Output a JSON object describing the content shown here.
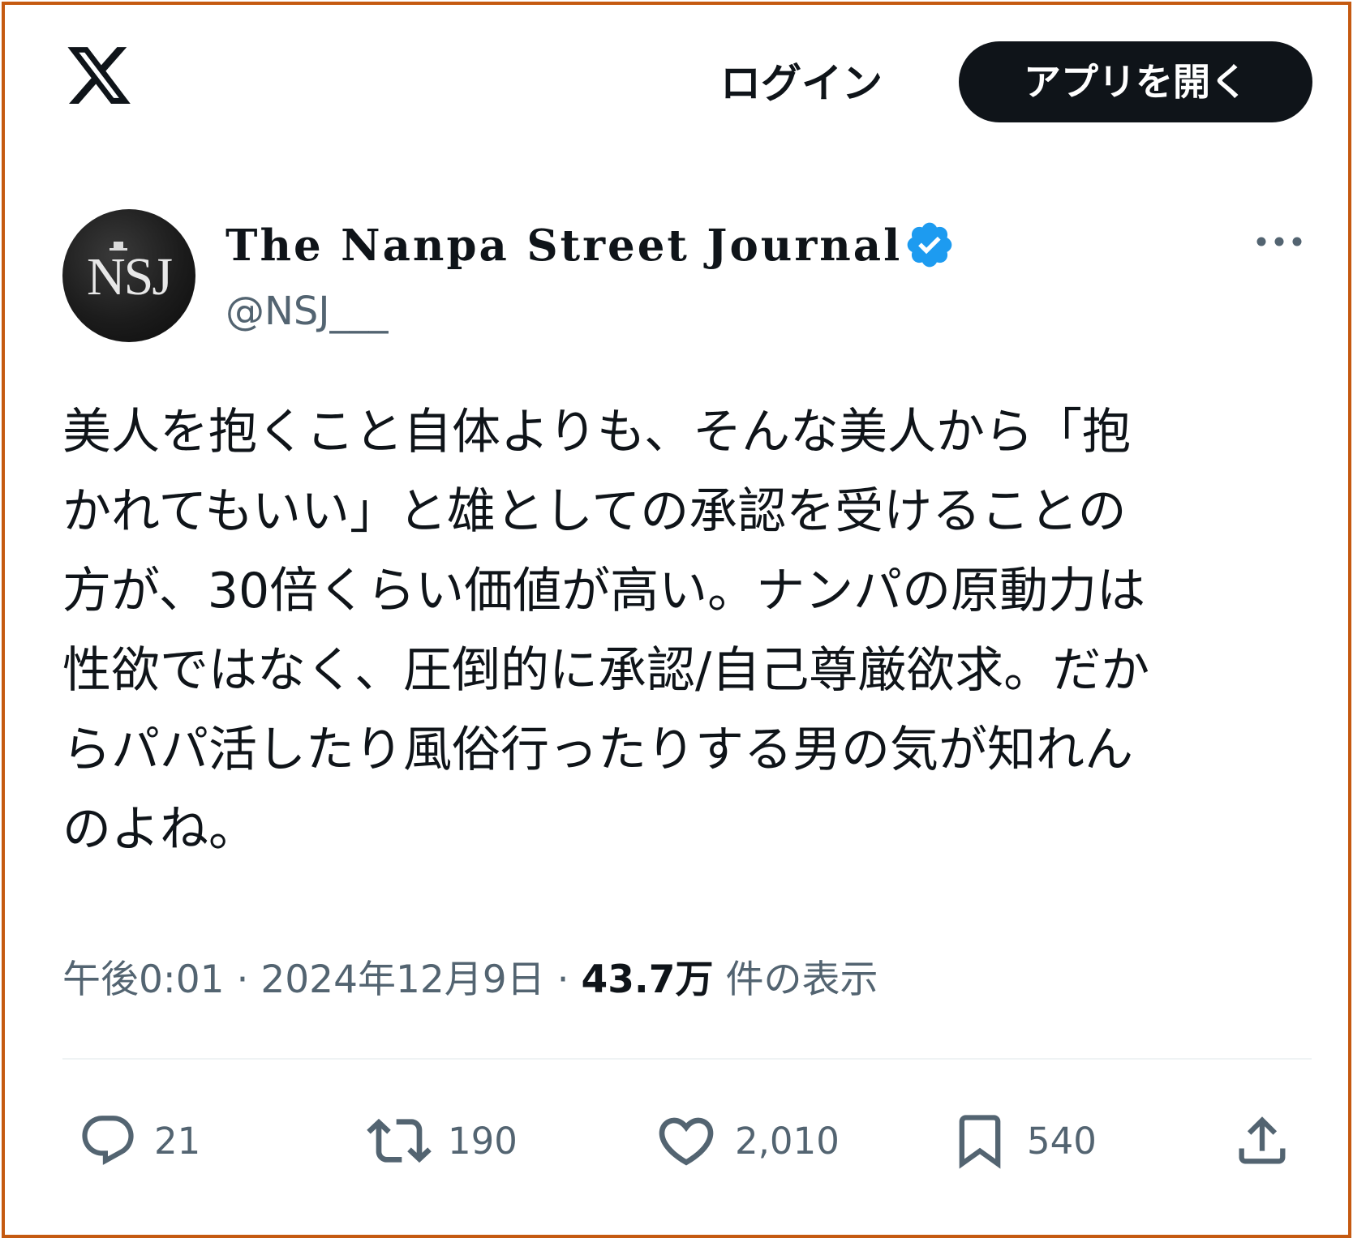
{
  "header": {
    "logo_icon": "x-logo-icon",
    "login_label": "ログイン",
    "open_app_label": "アプリを開く"
  },
  "author": {
    "avatar_text": "NSJ",
    "display_name": "The Nanpa Street Journal",
    "verified_icon": "verified-badge-icon",
    "verified_color": "#1d9bf0",
    "handle": "@NSJ___",
    "more_icon": "more-options-icon"
  },
  "tweet": {
    "lines": [
      "美人を抱くこと自体よりも、そんな美人から「抱",
      "かれてもいい」と雄としての承認を受けることの",
      "方が、30倍くらい価値が高い。ナンパの原動力は",
      "性欲ではなく、圧倒的に承認/自己尊厳欲求。だか",
      "らパパ活したり風俗行ったりする男の気が知れん",
      "のよね。"
    ]
  },
  "meta": {
    "time": "午後0:01",
    "separator": " · ",
    "date": "2024年12月9日",
    "views_count": "43.7万",
    "views_label": " 件の表示"
  },
  "actions": {
    "reply_count": "21",
    "retweet_count": "190",
    "like_count": "2,010",
    "bookmark_count": "540"
  },
  "colors": {
    "frame_border": "#c55a11",
    "text_primary": "#0f1419",
    "text_secondary": "#536471",
    "button_bg": "#0f1419"
  }
}
